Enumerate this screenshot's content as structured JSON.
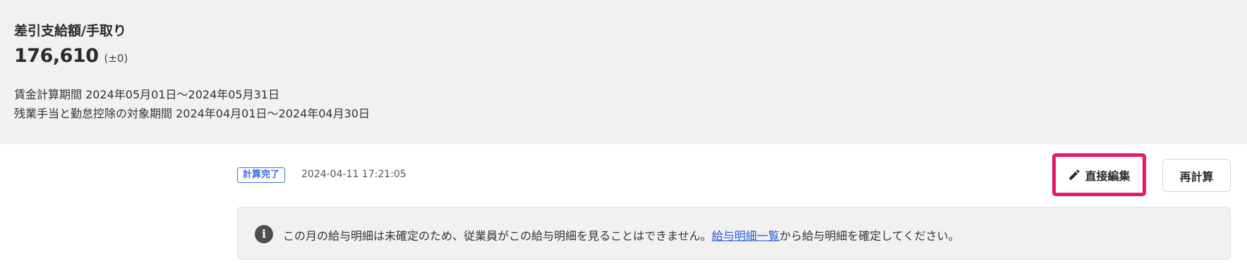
{
  "summary": {
    "title": "差引支給額/手取り",
    "amount": "176,610",
    "amount_diff": "(±0)",
    "wage_period": "賃金計算期間 2024年05月01日～2024年05月31日",
    "overtime_period": "残業手当と勤怠控除の対象期間 2024年04月01日～2024年04月30日"
  },
  "status": {
    "badge": "計算完了",
    "timestamp": "2024-04-11 17:21:05"
  },
  "actions": {
    "edit_label": "直接編集",
    "recalc_label": "再計算"
  },
  "notice": {
    "icon": "info-icon",
    "text_before": "この月の給与明細は未確定のため、従業員がこの給与明細を見ることはできません。",
    "link_text": "給与明細一覧",
    "text_after": "から給与明細を確定してください。"
  },
  "colors": {
    "badge_blue": "#3d6fd8",
    "highlight_pink": "#e5196b",
    "link_blue": "#2b5bd1",
    "summary_bg": "#f2f1f0"
  }
}
